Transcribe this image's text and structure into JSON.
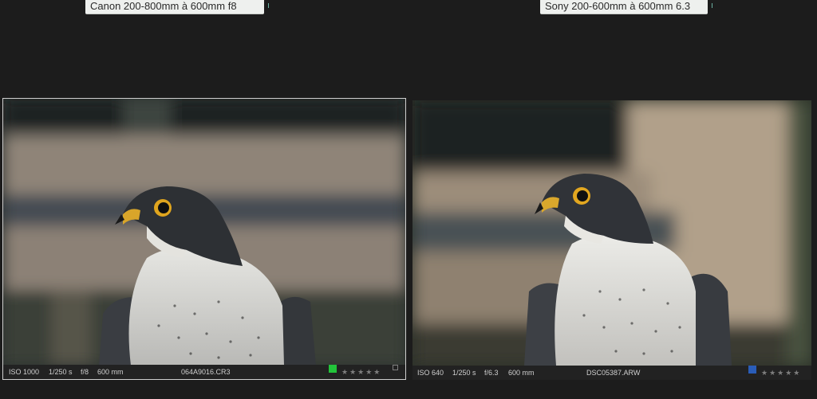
{
  "captions": {
    "left": "Canon 200-800mm à 600mm f8",
    "right": "Sony 200-600mm à 600mm 6.3"
  },
  "panels": {
    "left": {
      "iso": "ISO 1000",
      "shutter": "1/250 s",
      "aperture": "f/8",
      "focal": "600 mm",
      "filename": "064A9016.CR3",
      "label_color": "#22c43a",
      "stars": "★★★★★"
    },
    "right": {
      "iso": "ISO 640",
      "shutter": "1/250 s",
      "aperture": "f/6.3",
      "focal": "600 mm",
      "filename": "DSC05387.ARW",
      "label_color": "#2a5db8",
      "stars": "★★★★★"
    }
  }
}
